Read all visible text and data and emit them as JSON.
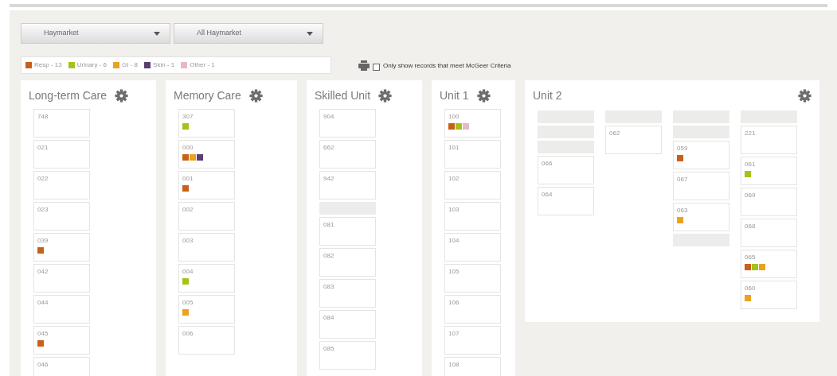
{
  "filters": [
    {
      "value": "Haymarket"
    },
    {
      "value": "All Haymarket"
    }
  ],
  "legend": [
    {
      "label": "Resp - 13",
      "color": "#c8601a"
    },
    {
      "label": "Urinary - 6",
      "color": "#a4c21c"
    },
    {
      "label": "GI - 8",
      "color": "#eba21f"
    },
    {
      "label": "Skin - 1",
      "color": "#5b3f73"
    },
    {
      "label": "Other - 1",
      "color": "#e7b9c4"
    }
  ],
  "mcgeer_filter": {
    "label": "Only show records that meet McGeer Criteria",
    "checked": false
  },
  "units": [
    {
      "name": "Long-term Care",
      "columns": [
        [
          {
            "kind": "room",
            "number": "748"
          },
          {
            "kind": "room",
            "number": "021"
          },
          {
            "kind": "room",
            "number": "022"
          },
          {
            "kind": "room",
            "number": "023"
          },
          {
            "kind": "room",
            "number": "039",
            "flags": [
              {
                "color": "#c8601a"
              }
            ]
          },
          {
            "kind": "room",
            "number": "042"
          },
          {
            "kind": "room",
            "number": "044"
          },
          {
            "kind": "room",
            "number": "045",
            "flags": [
              {
                "color": "#c8601a"
              }
            ]
          },
          {
            "kind": "room",
            "number": "046"
          }
        ]
      ]
    },
    {
      "name": "Memory Care",
      "columns": [
        [
          {
            "kind": "room",
            "number": "307",
            "flags": [
              {
                "color": "#a4c21c"
              }
            ]
          },
          {
            "kind": "room",
            "number": "000",
            "flags": [
              {
                "color": "#c8601a"
              },
              {
                "color": "#eba21f"
              },
              {
                "color": "#5b3f73"
              }
            ]
          },
          {
            "kind": "room",
            "number": "001",
            "flags": [
              {
                "color": "#c8601a"
              }
            ]
          },
          {
            "kind": "room",
            "number": "002"
          },
          {
            "kind": "room",
            "number": "003"
          },
          {
            "kind": "room",
            "number": "004",
            "flags": [
              {
                "color": "#a4c21c"
              }
            ]
          },
          {
            "kind": "room",
            "number": "005",
            "flags": [
              {
                "color": "#eba21f"
              }
            ]
          },
          {
            "kind": "room",
            "number": "006"
          }
        ]
      ]
    },
    {
      "name": "Skilled Unit",
      "columns": [
        [
          {
            "kind": "room",
            "number": "904"
          },
          {
            "kind": "room",
            "number": "662"
          },
          {
            "kind": "room",
            "number": "942"
          },
          {
            "kind": "empty"
          },
          {
            "kind": "room",
            "number": "081"
          },
          {
            "kind": "room",
            "number": "082"
          },
          {
            "kind": "room",
            "number": "083"
          },
          {
            "kind": "room",
            "number": "084"
          },
          {
            "kind": "room",
            "number": "085"
          }
        ]
      ]
    },
    {
      "name": "Unit 1",
      "columns": [
        [
          {
            "kind": "room",
            "number": "100",
            "flags": [
              {
                "color": "#c8601a"
              },
              {
                "color": "#a4c21c"
              },
              {
                "color": "#e7b9c4"
              }
            ]
          },
          {
            "kind": "room",
            "number": "101"
          },
          {
            "kind": "room",
            "number": "102"
          },
          {
            "kind": "room",
            "number": "103"
          },
          {
            "kind": "room",
            "number": "104"
          },
          {
            "kind": "room",
            "number": "105"
          },
          {
            "kind": "room",
            "number": "106"
          },
          {
            "kind": "room",
            "number": "107"
          },
          {
            "kind": "room",
            "number": "108"
          }
        ]
      ]
    },
    {
      "name": "Unit 2",
      "columns": [
        [
          {
            "kind": "empty"
          },
          {
            "kind": "empty"
          },
          {
            "kind": "empty"
          },
          {
            "kind": "room",
            "number": "066"
          },
          {
            "kind": "room",
            "number": "064"
          }
        ],
        [
          {
            "kind": "empty"
          },
          {
            "kind": "room",
            "number": "062"
          }
        ],
        [
          {
            "kind": "empty"
          },
          {
            "kind": "empty"
          },
          {
            "kind": "room",
            "number": "059",
            "flags": [
              {
                "color": "#c8601a"
              }
            ]
          },
          {
            "kind": "room",
            "number": "067"
          },
          {
            "kind": "room",
            "number": "063",
            "flags": [
              {
                "color": "#eba21f"
              }
            ]
          },
          {
            "kind": "empty"
          }
        ],
        [
          {
            "kind": "empty"
          },
          {
            "kind": "room",
            "number": "221"
          },
          {
            "kind": "room",
            "number": "061",
            "flags": [
              {
                "color": "#a4c21c"
              }
            ]
          },
          {
            "kind": "room",
            "number": "069"
          },
          {
            "kind": "room",
            "number": "068"
          },
          {
            "kind": "room",
            "number": "065",
            "flags": [
              {
                "color": "#c8601a"
              },
              {
                "color": "#a4c21c"
              },
              {
                "color": "#eba21f"
              }
            ]
          },
          {
            "kind": "room",
            "number": "060",
            "flags": [
              {
                "color": "#eba21f"
              }
            ]
          }
        ]
      ]
    }
  ]
}
